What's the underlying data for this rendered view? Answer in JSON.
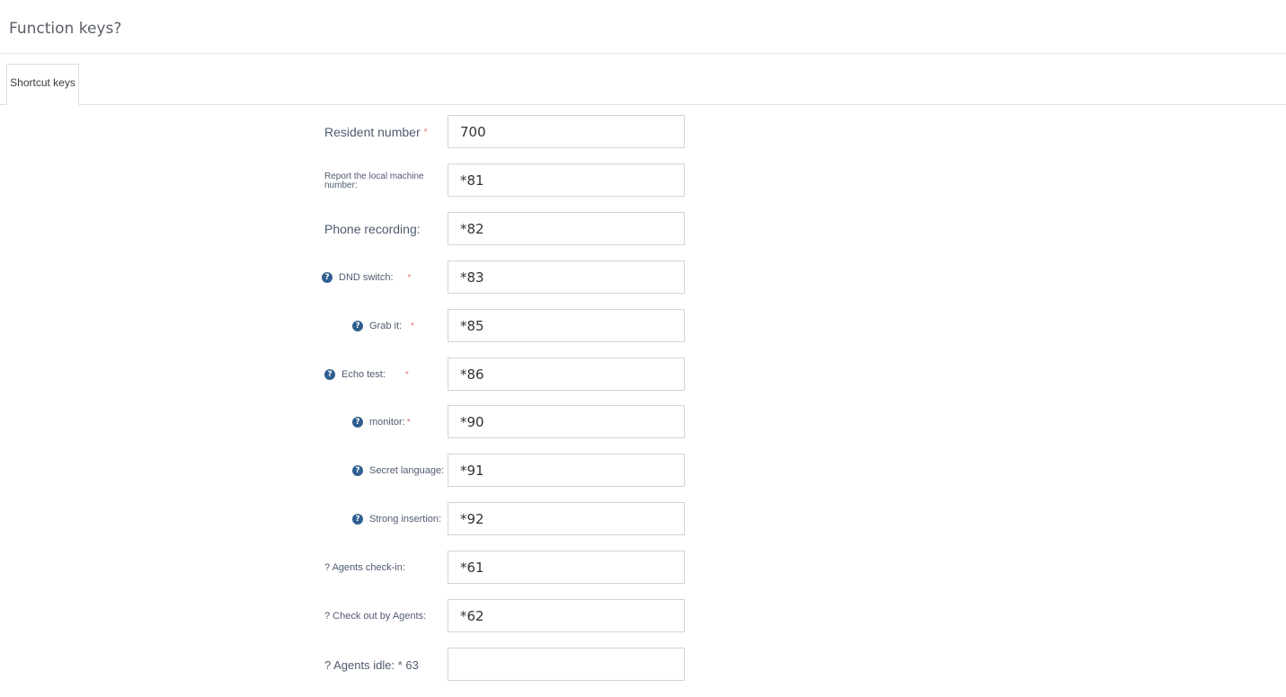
{
  "page": {
    "title": "Function keys?"
  },
  "tabs": [
    {
      "label": "Shortcut keys"
    }
  ],
  "form": {
    "rows": [
      {
        "label": "Resident number",
        "value": "700"
      },
      {
        "label_line1": "Report the local machine",
        "label_line2": "number:",
        "value": "*81"
      },
      {
        "label": "Phone recording:",
        "value": "*82"
      },
      {
        "label": "DND switch:",
        "value": "*83"
      },
      {
        "label": "Grab it:",
        "value": "*85"
      },
      {
        "label": "Echo test:",
        "value": "*86"
      },
      {
        "label": "monitor:",
        "value": "*90"
      },
      {
        "label": "Secret language:",
        "value": "*91"
      },
      {
        "label": "Strong insertion:",
        "value": "*92"
      },
      {
        "label": "? Agents check-in:",
        "value": "*61"
      },
      {
        "label": "? Check out by Agents:",
        "value": "*62"
      },
      {
        "label": "? Agents idle: * 63",
        "value": ""
      }
    ],
    "required_mark": "*",
    "help_icon": "question-circle-icon"
  },
  "colors": {
    "help_icon": "#2f5f8f",
    "required": "#e07070",
    "label": "#4f5b70"
  }
}
